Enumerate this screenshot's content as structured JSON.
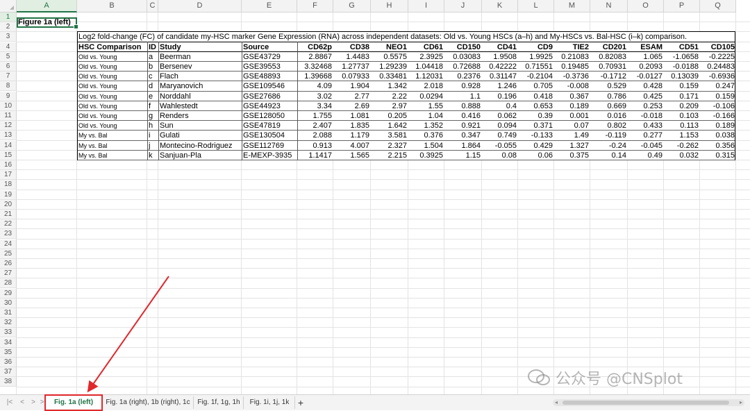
{
  "columns": [
    "A",
    "B",
    "C",
    "D",
    "E",
    "F",
    "G",
    "H",
    "I",
    "J",
    "K",
    "L",
    "M",
    "N",
    "O",
    "P",
    "Q"
  ],
  "selected_column": "A",
  "rows": [
    "1",
    "2",
    "3",
    "4",
    "5",
    "6",
    "7",
    "8",
    "9",
    "10",
    "11",
    "12",
    "13",
    "14",
    "15",
    "16",
    "17",
    "18",
    "19",
    "20",
    "21",
    "22",
    "23",
    "24",
    "25",
    "26",
    "27",
    "28",
    "29",
    "30",
    "31",
    "32",
    "33",
    "34",
    "35",
    "36",
    "37",
    "38"
  ],
  "selected_row": "1",
  "cell_A1": "Figure 1a (left)",
  "caption": "Log2 fold-change (FC) of candidate my-HSC marker Gene Expression (RNA) across independent datasets: Old vs. Young HSCs (a–h) and My-HSCs vs. Bal-HSC (i–k) comparison.",
  "table_headers": [
    "HSC Comparison",
    "ID",
    "Study",
    "Source",
    "CD62p",
    "CD38",
    "NEO1",
    "CD61",
    "CD150",
    "CD41",
    "CD9",
    "TIE2",
    "CD201",
    "ESAM",
    "CD51",
    "CD105"
  ],
  "table_rows": [
    [
      "Old vs. Young",
      "a",
      "Beerman",
      "GSE43729",
      "2.8867",
      "1.4483",
      "0.5575",
      "2.3925",
      "0.03083",
      "1.9508",
      "1.9925",
      "0.21083",
      "0.82083",
      "1.065",
      "-1.0658",
      "-0.2225"
    ],
    [
      "Old vs. Young",
      "b",
      "Bersenev",
      "GSE39553",
      "3.32468",
      "1.27737",
      "1.29239",
      "1.04418",
      "0.72688",
      "0.42222",
      "0.71551",
      "0.19485",
      "0.70931",
      "0.2093",
      "-0.0188",
      "0.24483"
    ],
    [
      "Old vs. Young",
      "c",
      "Flach",
      "GSE48893",
      "1.39668",
      "0.07933",
      "0.33481",
      "1.12031",
      "0.2376",
      "0.31147",
      "-0.2104",
      "-0.3736",
      "-0.1712",
      "-0.0127",
      "0.13039",
      "-0.6936"
    ],
    [
      "Old vs. Young",
      "d",
      "Maryanovich",
      "GSE109546",
      "4.09",
      "1.904",
      "1.342",
      "2.018",
      "0.928",
      "1.246",
      "0.705",
      "-0.008",
      "0.529",
      "0.428",
      "0.159",
      "0.247"
    ],
    [
      "Old vs. Young",
      "e",
      "Norddahl",
      "GSE27686",
      "3.02",
      "2.77",
      "2.22",
      "0.0294",
      "1.1",
      "0.196",
      "0.418",
      "0.367",
      "0.786",
      "0.425",
      "0.171",
      "0.159"
    ],
    [
      "Old vs. Young",
      "f",
      "Wahlestedt",
      "GSE44923",
      "3.34",
      "2.69",
      "2.97",
      "1.55",
      "0.888",
      "0.4",
      "0.653",
      "0.189",
      "0.669",
      "0.253",
      "0.209",
      "-0.106"
    ],
    [
      "Old vs. Young",
      "g",
      "Renders",
      "GSE128050",
      "1.755",
      "1.081",
      "0.205",
      "1.04",
      "0.416",
      "0.062",
      "0.39",
      "0.001",
      "0.016",
      "-0.018",
      "0.103",
      "-0.166"
    ],
    [
      "Old vs. Young",
      "h",
      "Sun",
      "GSE47819",
      "2.407",
      "1.835",
      "1.642",
      "1.352",
      "0.921",
      "0.094",
      "0.371",
      "0.07",
      "0.802",
      "0.433",
      "0.113",
      "0.189"
    ],
    [
      "My vs. Bal",
      "i",
      "Gulati",
      "GSE130504",
      "2.088",
      "1.179",
      "3.581",
      "0.376",
      "0.347",
      "0.749",
      "-0.133",
      "1.49",
      "-0.119",
      "0.277",
      "1.153",
      "0.038"
    ],
    [
      "My vs. Bal",
      "j",
      "Montecino-Rodriguez",
      "GSE112769",
      "0.913",
      "4.007",
      "2.327",
      "1.504",
      "1.864",
      "-0.055",
      "0.429",
      "1.327",
      "-0.24",
      "-0.045",
      "-0.262",
      "0.356"
    ],
    [
      "My vs. Bal",
      "k",
      "Sanjuan-Pla",
      "E-MEXP-3935",
      "1.1417",
      "1.565",
      "2.215",
      "0.3925",
      "1.15",
      "0.08",
      "0.06",
      "0.375",
      "0.14",
      "0.49",
      "0.032",
      "0.315"
    ]
  ],
  "sheet_tabs": [
    "Fig. 1a (left)",
    "Fig. 1a (right), 1b (right), 1c",
    "Fig. 1f, 1g, 1h",
    "Fig. 1i, 1j, 1k"
  ],
  "active_tab": "Fig. 1a (left)",
  "add_tab_label": "+",
  "nav_buttons": [
    "|<",
    "<",
    ">",
    ">|"
  ],
  "watermark_text": "公众号 @CNSplot",
  "colors": {
    "accent": "#217346",
    "highlight": "#e0282c",
    "grid": "#e3e3e3"
  }
}
